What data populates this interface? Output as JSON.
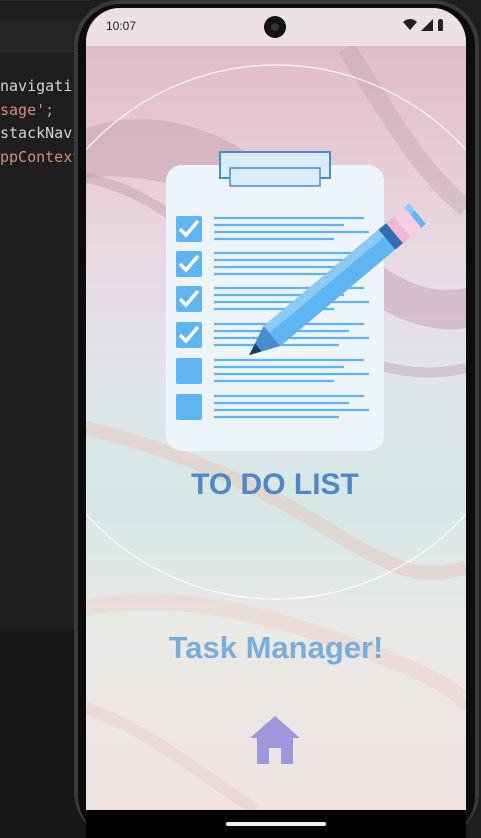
{
  "ide": {
    "lines": [
      "navigati",
      "sage';",
      "stackNavi",
      "ppContext"
    ]
  },
  "status": {
    "time": "10:07"
  },
  "illustration": {
    "caption": "TO DO LIST",
    "checked_count": 4,
    "total_rows": 6
  },
  "main": {
    "title": "Task Manager!"
  },
  "icons": {
    "home": "home-icon"
  },
  "colors": {
    "title": "#78aedb",
    "home": "#9f97dd",
    "clipboard": "#eef4fb",
    "check": "#5fb4f2",
    "caption": "#4f87c8"
  }
}
